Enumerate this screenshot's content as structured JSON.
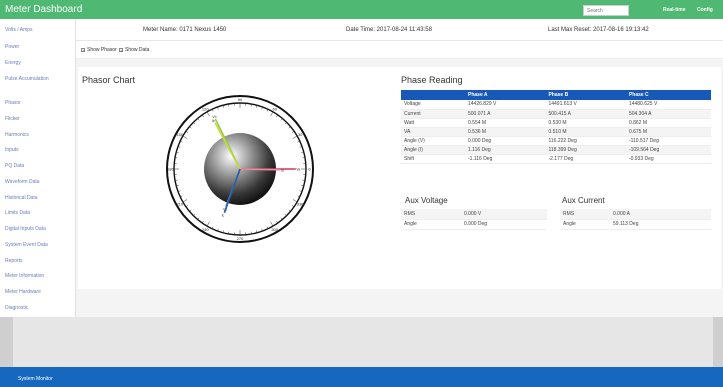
{
  "app": {
    "title": "Meter Dashboard",
    "search_placeholder": "Search",
    "links": [
      "Real-time",
      "Config"
    ]
  },
  "sidebar": {
    "items": [
      "Volts / Amps",
      "Power",
      "Energy",
      "Pulse Accumulation",
      "Phasor",
      "Flicker",
      "Harmonics",
      "Inputs",
      "PQ Data",
      "Waveform Data",
      "Historical Data",
      "Limits Data",
      "Digital Inputs Data",
      "System Event Data",
      "Reports",
      "Meter Information",
      "Meter Hardware",
      "Diagnostic"
    ]
  },
  "header": {
    "meter_name": "Meter Name: 0171 Nexus 1450",
    "date_time": "Date Time: 2017-08-24 11:43:58",
    "last_max_reset": "Last Max Reset: 2017-08-16 19:13:42"
  },
  "toggles": {
    "show_phasor": "Show Phasor",
    "show_data": "Show Data"
  },
  "phasor": {
    "title": "Phasor Chart",
    "angle_labels": [
      "0",
      "30",
      "60",
      "90",
      "120",
      "150",
      "180",
      "210",
      "240",
      "270",
      "300",
      "330"
    ],
    "vectors": [
      {
        "label": "Va",
        "angle_deg": 0,
        "magnitude": 0.9,
        "color": "#d9335a"
      },
      {
        "label": "Ia",
        "angle_deg": -1.2,
        "magnitude": 0.65,
        "color": "#e88aa0"
      },
      {
        "label": "Vb",
        "angle_deg": 116.2,
        "magnitude": 0.9,
        "color": "#8fce4a"
      },
      {
        "label": "Ib",
        "angle_deg": 118.4,
        "magnitude": 0.85,
        "color": "#c8d83a"
      },
      {
        "label": "Vc",
        "angle_deg": -110.5,
        "magnitude": 0.65,
        "color": "#4f86c6"
      },
      {
        "label": "Ic",
        "angle_deg": -109.6,
        "magnitude": 0.75,
        "color": "#2d5ea8"
      }
    ],
    "colors": {
      "ring": "#111111",
      "accent_blue": "#1659b9"
    }
  },
  "phase_reading": {
    "title": "Phase Reading",
    "columns": [
      "",
      "Phase A",
      "Phase B",
      "Phase C"
    ],
    "rows": [
      [
        "Voltage",
        "14426.829 V",
        "14491.613 V",
        "14480.625 V"
      ],
      [
        "Current",
        "500.071 A",
        "500.415 A",
        "504.304 A"
      ],
      [
        "Watt",
        "0.554 M",
        "0.530 M",
        "0.862 M"
      ],
      [
        "VA",
        "0.536 M",
        "0.510 M",
        "0.675 M"
      ],
      [
        "Angle (V)",
        "0.000 Deg",
        "116.222 Deg",
        "-110.517 Deg"
      ],
      [
        "Angle (I)",
        "1.116 Deg",
        "118.399 Deg",
        "-109.564 Deg"
      ],
      [
        "Shift",
        "-1.116 Deg",
        "-2.177 Deg",
        "-0.933 Deg"
      ]
    ]
  },
  "aux_voltage": {
    "title": "Aux Voltage",
    "rows": [
      [
        "RMS",
        "0.000 V"
      ],
      [
        "Angle",
        "0.000 Deg"
      ]
    ]
  },
  "aux_current": {
    "title": "Aux Current",
    "rows": [
      [
        "RMS",
        "0.000 A"
      ],
      [
        "Angle",
        "59.113 Deg"
      ]
    ]
  },
  "status_bar": {
    "text": "System Monitor"
  }
}
